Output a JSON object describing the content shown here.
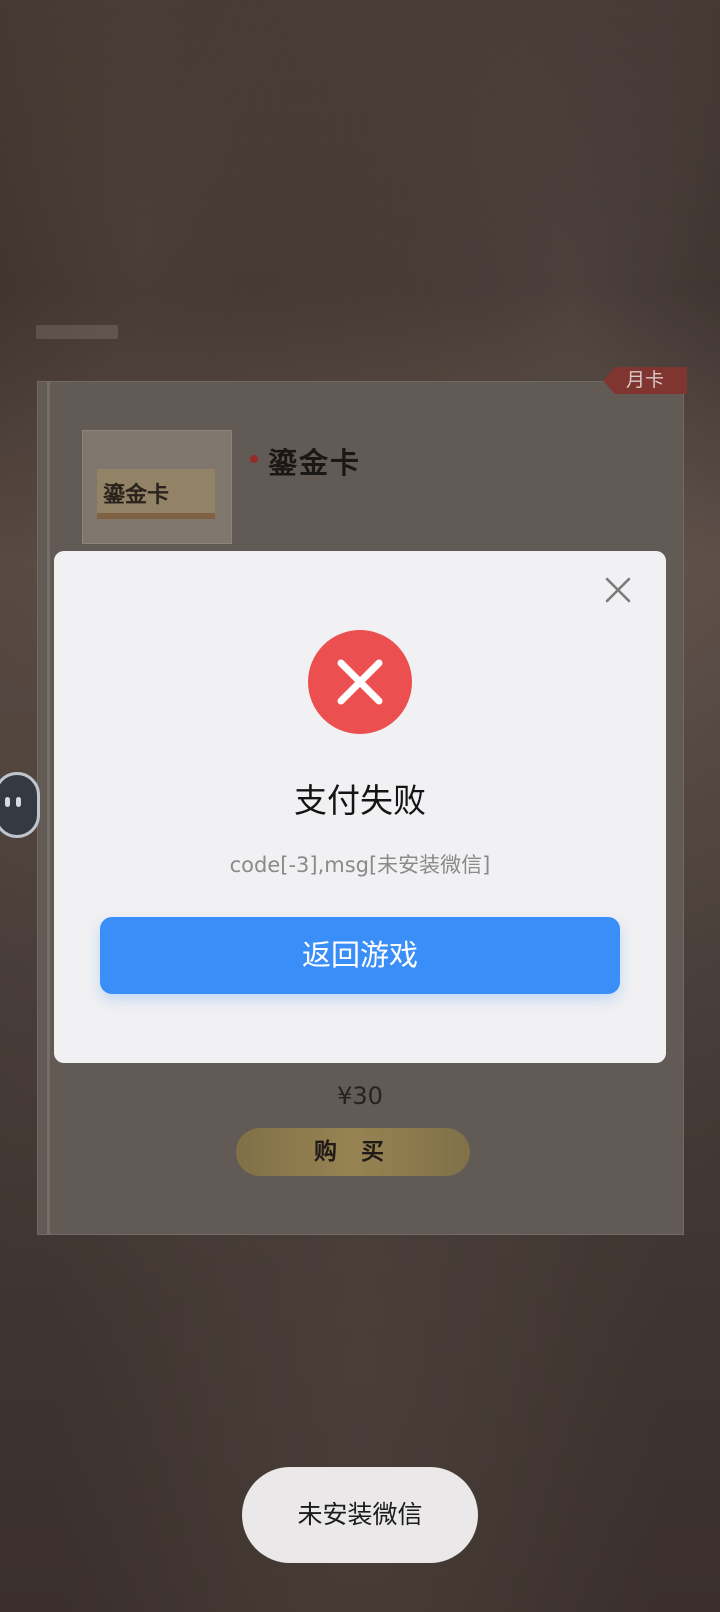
{
  "background_card": {
    "tag": "月卡",
    "thumbnail_label": "鎏金卡",
    "title": "鎏金卡",
    "price": "¥30",
    "buy_label": "购 买"
  },
  "dialog": {
    "title": "支付失败",
    "message": "code[-3],msg[未安装微信]",
    "primary_button": "返回游戏",
    "close_icon": "close-icon",
    "status_icon": "error-icon",
    "accent_color": "#3a8ef8",
    "error_color": "#ec4f4f"
  },
  "toast": {
    "text": "未安装微信"
  }
}
